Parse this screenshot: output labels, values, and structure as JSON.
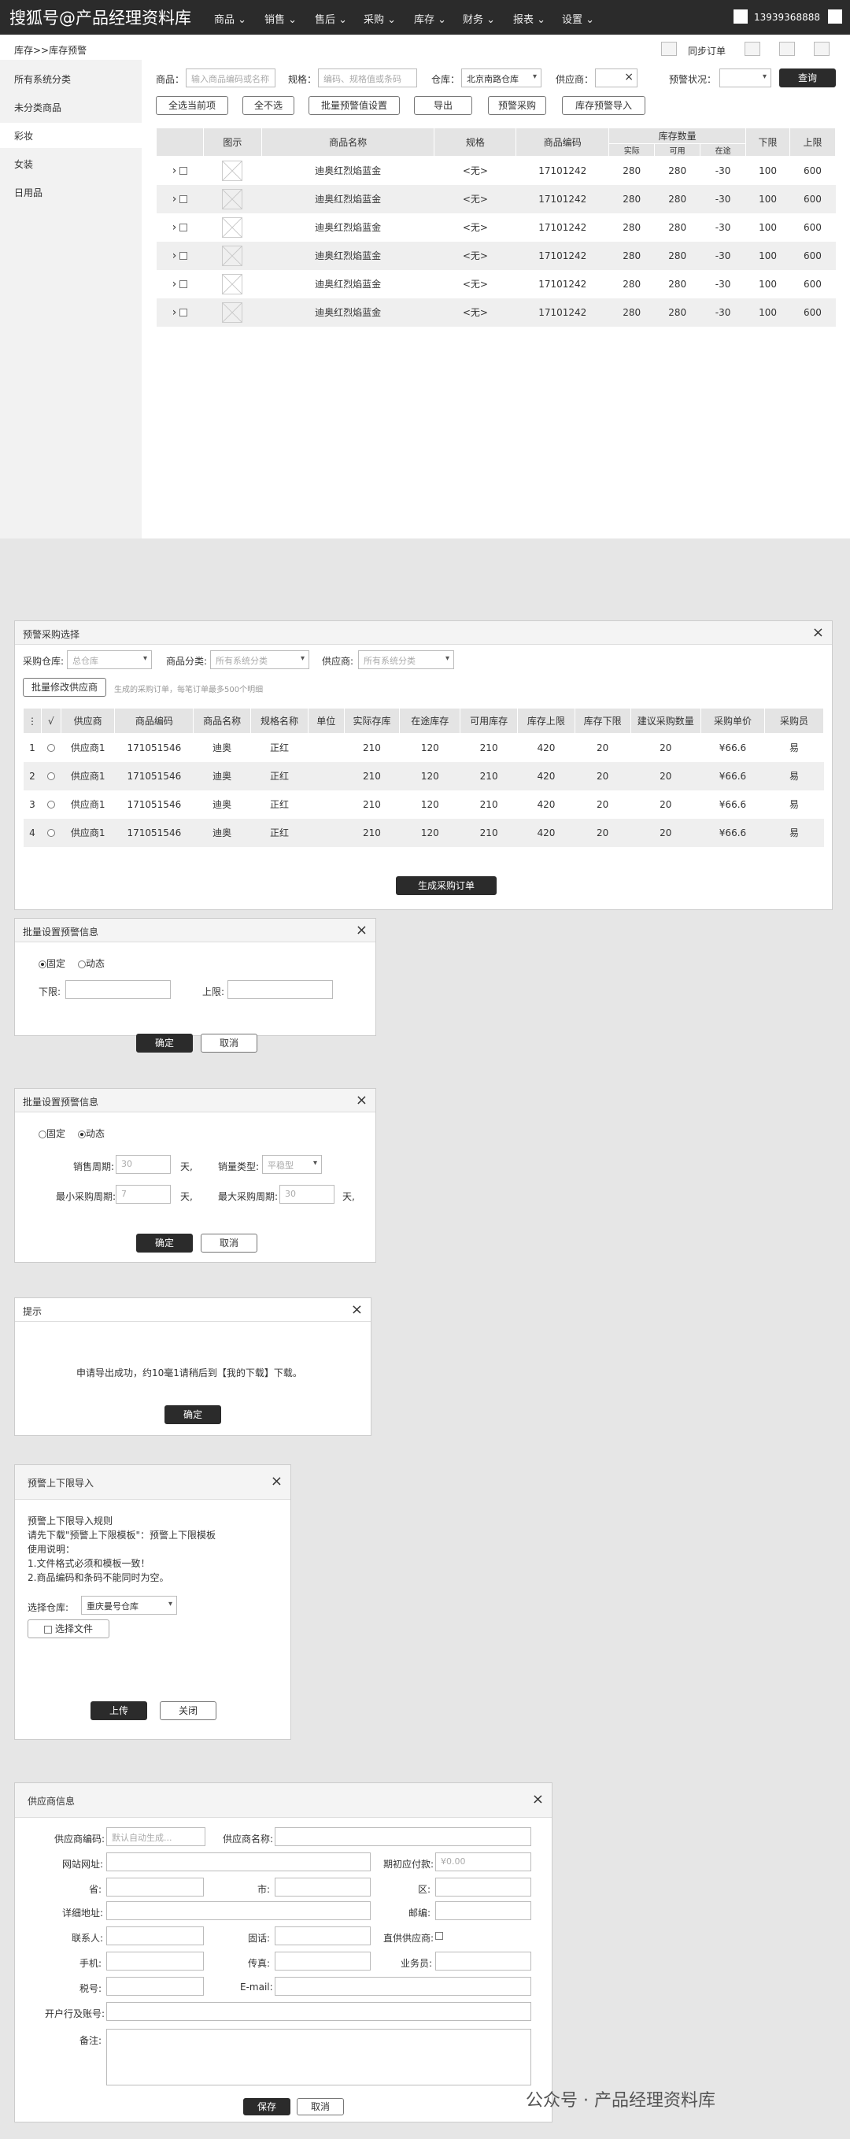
{
  "topnav": {
    "brand": "搜狐号@产品经理资料库",
    "items": [
      "商品",
      "销售",
      "售后",
      "采购",
      "库存",
      "财务",
      "报表",
      "设置"
    ],
    "user": "13939368888"
  },
  "breadcrumb": "库存>>库存预警",
  "sync_label": "同步订单",
  "sidebar": [
    "所有系统分类",
    "未分类商品",
    "彩妆",
    "女装",
    "日用品"
  ],
  "filters": {
    "goods_label": "商品：",
    "goods_placeholder": "输入商品编码或名称",
    "spec_label": "规格：",
    "spec_placeholder": "编码、规格值或条码",
    "warehouse_label": "仓库：",
    "warehouse_value": "北京南路仓库",
    "supplier_label": "供应商：",
    "supplier_clear": "×",
    "warn_label": "预警状况：",
    "query": "查询"
  },
  "actions": [
    "全选当前项",
    "全不选",
    "批量预警值设置",
    "导出",
    "预警采购",
    "库存预警导入"
  ],
  "main_table": {
    "headers": [
      "图示",
      "商品名称",
      "规格",
      "商品编码",
      "库存数量",
      "下限",
      "上限"
    ],
    "sub_headers": [
      "实际",
      "可用",
      "在途"
    ],
    "rows": [
      [
        "迪奥红烈焰蓝金",
        "<无>",
        "17101242",
        "280",
        "280",
        "-30",
        "100",
        "600"
      ],
      [
        "迪奥红烈焰蓝金",
        "<无>",
        "17101242",
        "280",
        "280",
        "-30",
        "100",
        "600"
      ],
      [
        "迪奥红烈焰蓝金",
        "<无>",
        "17101242",
        "280",
        "280",
        "-30",
        "100",
        "600"
      ],
      [
        "迪奥红烈焰蓝金",
        "<无>",
        "17101242",
        "280",
        "280",
        "-30",
        "100",
        "600"
      ],
      [
        "迪奥红烈焰蓝金",
        "<无>",
        "17101242",
        "280",
        "280",
        "-30",
        "100",
        "600"
      ],
      [
        "迪奥红烈焰蓝金",
        "<无>",
        "17101242",
        "280",
        "280",
        "-30",
        "100",
        "600"
      ]
    ]
  },
  "purchase_dialog": {
    "title": "预警采购选择",
    "close": "×",
    "warehouse_label": "采购仓库:",
    "warehouse_value": "总仓库",
    "category_label": "商品分类:",
    "category_value": "所有系统分类",
    "supplier_label": "供应商:",
    "supplier_value": "所有系统分类",
    "batch_btn": "批量修改供应商",
    "note": "生成的采购订单，每笔订单最多500个明细",
    "headers": [
      "⋮",
      "√",
      "供应商",
      "商品编码",
      "商品名称",
      "规格名称",
      "单位",
      "实际存库",
      "在途库存",
      "可用库存",
      "库存上限",
      "库存下限",
      "建议采购数量",
      "采购单价",
      "采购员"
    ],
    "rows": [
      [
        "1",
        "供应商1",
        "171051546",
        "迪奥",
        "正红",
        "",
        "210",
        "120",
        "210",
        "420",
        "20",
        "20",
        "¥66.6",
        "易"
      ],
      [
        "2",
        "供应商1",
        "171051546",
        "迪奥",
        "正红",
        "",
        "210",
        "120",
        "210",
        "420",
        "20",
        "20",
        "¥66.6",
        "易"
      ],
      [
        "3",
        "供应商1",
        "171051546",
        "迪奥",
        "正红",
        "",
        "210",
        "120",
        "210",
        "420",
        "20",
        "20",
        "¥66.6",
        "易"
      ],
      [
        "4",
        "供应商1",
        "171051546",
        "迪奥",
        "正红",
        "",
        "210",
        "120",
        "210",
        "420",
        "20",
        "20",
        "¥66.6",
        "易"
      ]
    ],
    "generate_btn": "生成采购订单"
  },
  "batch_fixed": {
    "title": "批量设置预警信息",
    "close": "×",
    "fixed": "固定",
    "dynamic": "动态",
    "lower_label": "下限:",
    "upper_label": "上限:",
    "ok": "确定",
    "cancel": "取消"
  },
  "batch_dynamic": {
    "title": "批量设置预警信息",
    "close": "×",
    "fixed": "固定",
    "dynamic": "动态",
    "sales_period_label": "销售周期:",
    "sales_period_value": "30",
    "day1": "天,",
    "sales_type_label": "销量类型:",
    "sales_type_value": "平稳型",
    "min_period_label": "最小采购周期:",
    "min_period_value": "7",
    "day2": "天,",
    "max_period_label": "最大采购周期:",
    "max_period_value": "30",
    "day3": "天,",
    "ok": "确定",
    "cancel": "取消"
  },
  "tip_dialog": {
    "title": "提示",
    "close": "×",
    "message": "申请导出成功，约10毫1请稍后到【我的下载】下载。",
    "ok": "确定"
  },
  "import_dialog": {
    "title": "预警上下限导入",
    "close": "×",
    "lines": [
      "预警上下限导入规则",
      "请先下载\"预警上下限模板\"：预警上下限模板",
      "使用说明：",
      "1.文件格式必须和模板一致！",
      "2.商品编码和条码不能同时为空。"
    ],
    "warehouse_label": "选择仓库:",
    "warehouse_value": "重庆曼号仓库",
    "choose_file": "选择文件",
    "upload": "上传",
    "close_btn": "关闭"
  },
  "supplier_dialog": {
    "title": "供应商信息",
    "close": "×",
    "code_label": "供应商编码:",
    "code_placeholder": "默认自动生成...",
    "name_label": "供应商名称:",
    "site_label": "网站网址:",
    "payable_label": "期初应付款:",
    "payable_placeholder": "¥0.00",
    "province_label": "省:",
    "city_label": "市:",
    "district_label": "区:",
    "address_label": "详细地址:",
    "zip_label": "邮编:",
    "contact_label": "联系人:",
    "phone_label": "固话:",
    "direct_label": "直供供应商:",
    "mobile_label": "手机:",
    "fax_label": "传真:",
    "sales_label": "业务员:",
    "tax_label": "税号:",
    "email_label": "E-mail:",
    "bank_label": "开户行及账号:",
    "remark_label": "备注:",
    "save": "保存",
    "cancel": "取消"
  },
  "watermark": "公众号 · 产品经理资料库"
}
